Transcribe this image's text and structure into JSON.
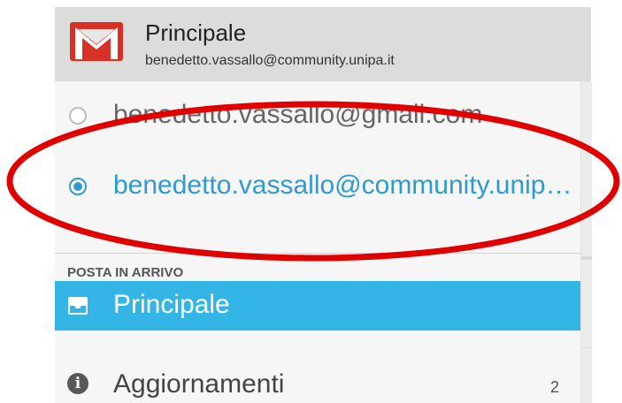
{
  "header": {
    "title": "Principale",
    "account": "benedetto.vassallo@community.unipa.it",
    "logo_icon": "gmail-logo-icon"
  },
  "accounts": [
    {
      "email": "benedetto.vassallo@gmail.com",
      "selected": false
    },
    {
      "email": "benedetto.vassallo@community.unipa.it",
      "selected": true
    }
  ],
  "section": {
    "label": "POSTA IN ARRIVO"
  },
  "nav": {
    "active": {
      "label": "Principale",
      "icon": "inbox-icon"
    },
    "items": [
      {
        "label": "Aggiornamenti",
        "count": "2",
        "icon": "info-icon"
      }
    ]
  },
  "colors": {
    "accent": "#33b5e5",
    "accent_text": "#2f9ad2",
    "annotation": "#e00000"
  }
}
